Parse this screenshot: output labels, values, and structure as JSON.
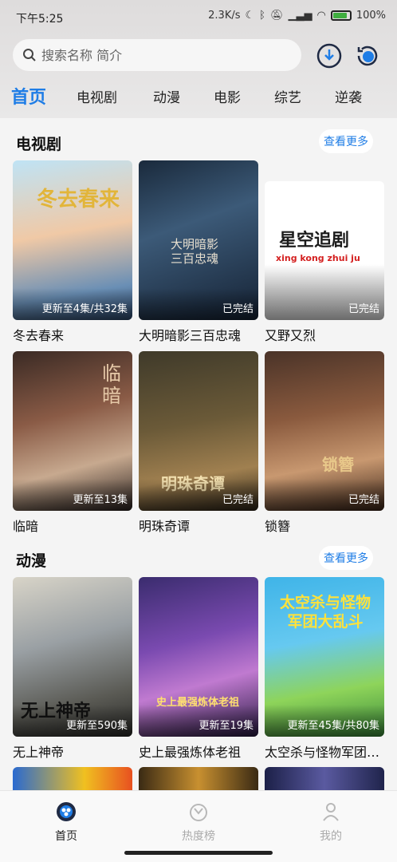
{
  "status_bar": {
    "time": "下午5:25",
    "net_speed": "2.3K/s",
    "battery": "100%"
  },
  "search": {
    "placeholder": "搜索名称 简介"
  },
  "top_icons": [
    "download-icon",
    "history-icon"
  ],
  "tabs": [
    {
      "label": "首页",
      "active": true
    },
    {
      "label": "电视剧"
    },
    {
      "label": "动漫"
    },
    {
      "label": "电影"
    },
    {
      "label": "综艺"
    },
    {
      "label": "逆袭"
    }
  ],
  "sections": [
    {
      "title": "电视剧",
      "more": "查看更多",
      "items": [
        {
          "name": "冬去春来",
          "badge": "更新至4集/共32集",
          "poster_text": "冬去春来"
        },
        {
          "name": "大明暗影三百忠魂",
          "badge": "已完结",
          "poster_text": "大明暗影三百忠魂"
        },
        {
          "name": "又野又烈",
          "badge": "已完结",
          "poster_text": "星空追剧",
          "poster_subtext": "xing kong zhui ju"
        },
        {
          "name": "临暗",
          "badge": "更新至13集",
          "poster_text": "临暗"
        },
        {
          "name": "明珠奇谭",
          "badge": "已完结",
          "poster_text": "明珠奇谭"
        },
        {
          "name": "锁簪",
          "badge": "已完结",
          "poster_text": "锁簪"
        }
      ]
    },
    {
      "title": "动漫",
      "more": "查看更多",
      "items": [
        {
          "name": "无上神帝",
          "badge": "更新至590集",
          "poster_text": "无上神帝"
        },
        {
          "name": "史上最强炼体老祖",
          "badge": "更新至19集",
          "poster_text": "史上最强炼体老祖"
        },
        {
          "name": "太空杀与怪物军团大乱斗",
          "badge": "更新至45集/共80集",
          "poster_text": "太空杀与怪物军团大乱斗"
        }
      ]
    }
  ],
  "bottom_nav": [
    {
      "label": "首页",
      "active": true
    },
    {
      "label": "热度榜"
    },
    {
      "label": "我的"
    }
  ],
  "colors": {
    "accent": "#1f7de6",
    "background": "#f4f4f4"
  }
}
